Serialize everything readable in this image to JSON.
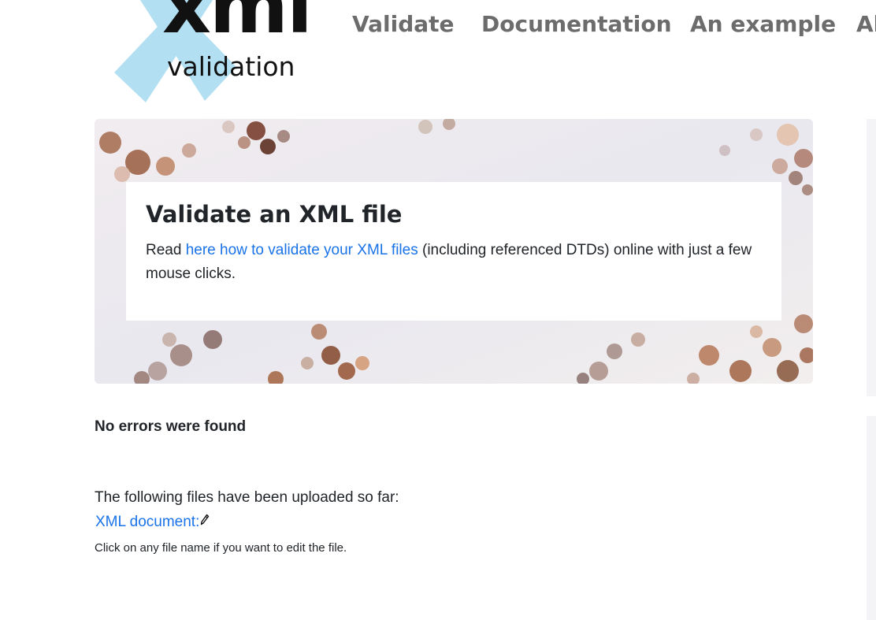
{
  "header": {
    "logo_main": "xml",
    "logo_sub": "validation",
    "nav": [
      "Validate",
      "Documentation",
      "An example",
      "Al"
    ]
  },
  "hero": {
    "title": "Validate an XML file",
    "text_before": "Read ",
    "link_text": "here how to validate your XML files",
    "text_after": " (including referenced DTDs) online with just a few mouse clicks."
  },
  "result": {
    "status": "No errors were found",
    "files_intro": "The following files have been uploaded so far:",
    "file_link": "XML document:",
    "hint": "Click on any file name if you want to edit the file."
  },
  "colors": {
    "link": "#1a73e8",
    "nav": "#6c6c6c",
    "logo_cross": "#b3dff2"
  },
  "icons": {
    "edit": "pencil-icon"
  }
}
